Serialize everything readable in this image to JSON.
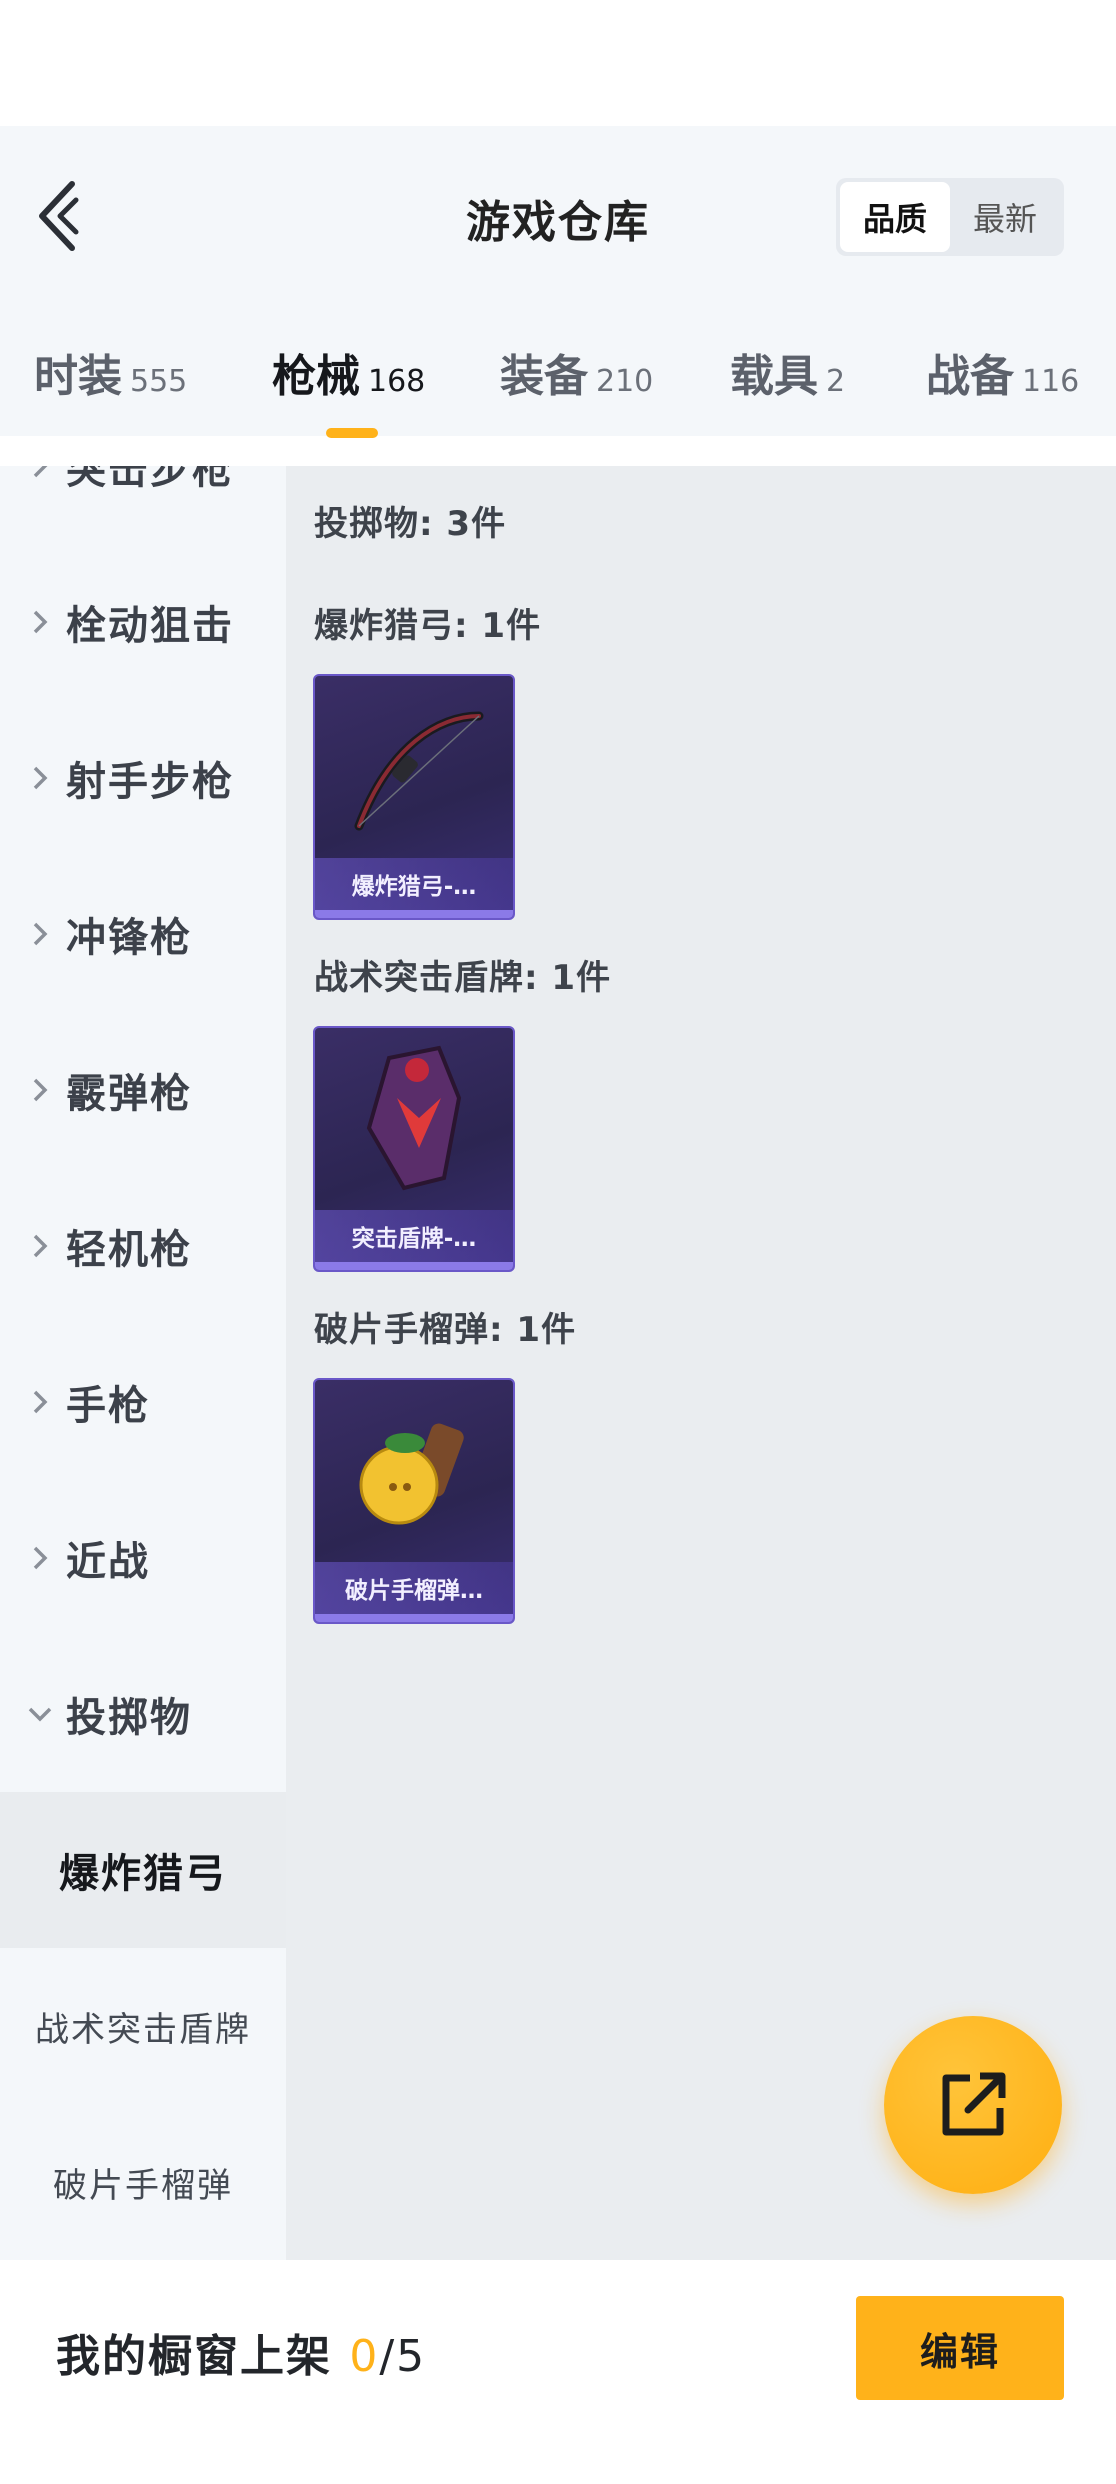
{
  "header": {
    "title": "游戏仓库",
    "sort_options": [
      "品质",
      "最新"
    ],
    "active_sort": "品质"
  },
  "tabs": [
    {
      "label": "时装",
      "count": "555"
    },
    {
      "label": "枪械",
      "count": "168"
    },
    {
      "label": "装备",
      "count": "210"
    },
    {
      "label": "载具",
      "count": "2"
    },
    {
      "label": "战备",
      "count": "116"
    }
  ],
  "sidebar": {
    "categories": [
      {
        "label": "突击步枪"
      },
      {
        "label": "栓动狙击"
      },
      {
        "label": "射手步枪"
      },
      {
        "label": "冲锋枪"
      },
      {
        "label": "霰弹枪"
      },
      {
        "label": "轻机枪"
      },
      {
        "label": "手枪"
      },
      {
        "label": "近战"
      },
      {
        "label": "投掷物"
      }
    ],
    "subcategories": [
      {
        "label": "爆炸猎弓"
      },
      {
        "label": "战术突击盾牌"
      },
      {
        "label": "破片手榴弹"
      }
    ]
  },
  "content": {
    "section_title": "投掷物: 3件",
    "groups": [
      {
        "title": "爆炸猎弓: 1件",
        "item_name": "爆炸猎弓-…",
        "icon": "bow-icon"
      },
      {
        "title": "战术突击盾牌: 1件",
        "item_name": "突击盾牌-…",
        "icon": "shield-icon"
      },
      {
        "title": "破片手榴弹: 1件",
        "item_name": "破片手榴弹…",
        "icon": "grenade-icon"
      }
    ]
  },
  "footer": {
    "label": "我的橱窗上架",
    "count": "0",
    "total": "/5",
    "edit_label": "编辑"
  },
  "colors": {
    "accent": "#ffb21a",
    "card_bg": "#2c2552",
    "card_border": "#6a58c8"
  }
}
